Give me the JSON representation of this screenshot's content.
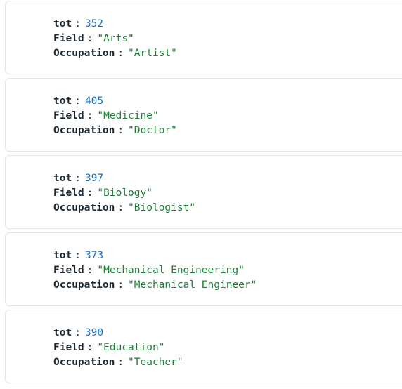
{
  "documents": [
    {
      "tot_key": "tot",
      "tot": "352",
      "field_key": "Field",
      "field": "Arts",
      "occupation_key": "Occupation",
      "occupation": "Artist"
    },
    {
      "tot_key": "tot",
      "tot": "405",
      "field_key": "Field",
      "field": "Medicine",
      "occupation_key": "Occupation",
      "occupation": "Doctor"
    },
    {
      "tot_key": "tot",
      "tot": "397",
      "field_key": "Field",
      "field": "Biology",
      "occupation_key": "Occupation",
      "occupation": "Biologist"
    },
    {
      "tot_key": "tot",
      "tot": "373",
      "field_key": "Field",
      "field": "Mechanical Engineering",
      "occupation_key": "Occupation",
      "occupation": "Mechanical Engineer"
    },
    {
      "tot_key": "tot",
      "tot": "390",
      "field_key": "Field",
      "field": "Education",
      "occupation_key": "Occupation",
      "occupation": "Teacher"
    }
  ],
  "colors": {
    "key": "#1b2733",
    "number": "#1a6fc2",
    "string": "#1f8038",
    "border": "#e3e6e8"
  }
}
